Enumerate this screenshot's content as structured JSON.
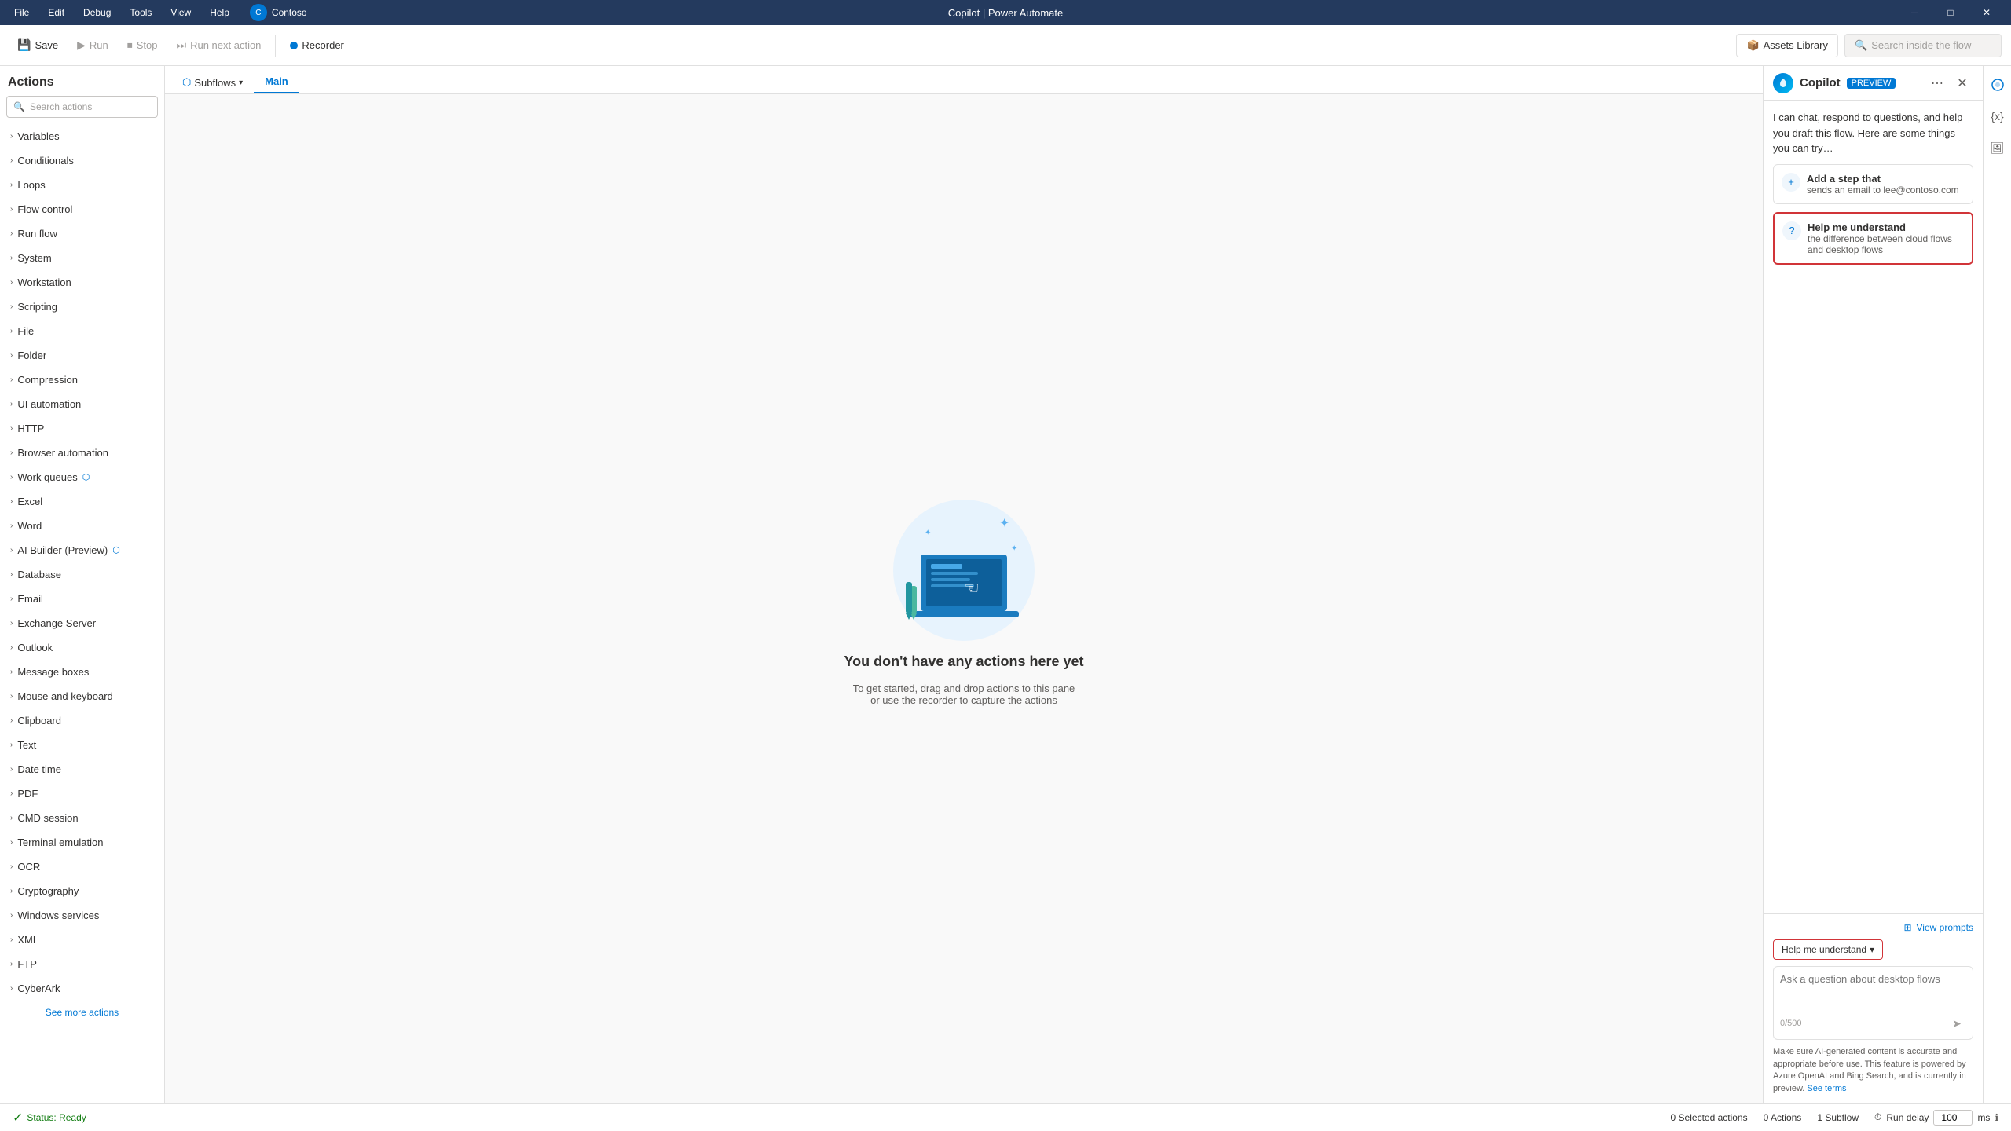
{
  "titlebar": {
    "app_name": "Copilot | Power Automate",
    "menu": [
      "File",
      "Edit",
      "Debug",
      "Tools",
      "View",
      "Help"
    ],
    "user": "Contoso",
    "minimize": "─",
    "restore": "□",
    "close": "✕"
  },
  "toolbar": {
    "save_label": "Save",
    "run_label": "Run",
    "stop_label": "Stop",
    "run_next_label": "Run next action",
    "recorder_label": "Recorder",
    "assets_label": "Assets Library",
    "search_flow_placeholder": "Search inside the flow"
  },
  "actions_panel": {
    "title": "Actions",
    "search_placeholder": "Search actions",
    "items": [
      {
        "label": "Variables"
      },
      {
        "label": "Conditionals"
      },
      {
        "label": "Loops"
      },
      {
        "label": "Flow control"
      },
      {
        "label": "Run flow"
      },
      {
        "label": "System"
      },
      {
        "label": "Workstation"
      },
      {
        "label": "Scripting"
      },
      {
        "label": "File"
      },
      {
        "label": "Folder"
      },
      {
        "label": "Compression"
      },
      {
        "label": "UI automation"
      },
      {
        "label": "HTTP"
      },
      {
        "label": "Browser automation"
      },
      {
        "label": "Work queues"
      },
      {
        "label": "Excel"
      },
      {
        "label": "Word"
      },
      {
        "label": "AI Builder (Preview)"
      },
      {
        "label": "Database"
      },
      {
        "label": "Email"
      },
      {
        "label": "Exchange Server"
      },
      {
        "label": "Outlook"
      },
      {
        "label": "Message boxes"
      },
      {
        "label": "Mouse and keyboard"
      },
      {
        "label": "Clipboard"
      },
      {
        "label": "Text"
      },
      {
        "label": "Date time"
      },
      {
        "label": "PDF"
      },
      {
        "label": "CMD session"
      },
      {
        "label": "Terminal emulation"
      },
      {
        "label": "OCR"
      },
      {
        "label": "Cryptography"
      },
      {
        "label": "Windows services"
      },
      {
        "label": "XML"
      },
      {
        "label": "FTP"
      },
      {
        "label": "CyberArk"
      }
    ],
    "see_more_label": "See more actions"
  },
  "flow_canvas": {
    "subflows_label": "Subflows",
    "main_tab_label": "Main",
    "empty_title": "You don't have any actions here yet",
    "empty_subtitle_line1": "To get started, drag and drop actions to this pane",
    "empty_subtitle_line2": "or use the recorder to capture the actions"
  },
  "copilot": {
    "title": "Copilot",
    "preview_label": "PREVIEW",
    "intro": "I can chat, respond to questions, and help you draft this flow. Here are some things you can try…",
    "suggestion1_title": "Add a step that",
    "suggestion1_sub": "sends an email to lee@contoso.com",
    "suggestion2_title": "Help me understand",
    "suggestion2_sub": "the difference between cloud flows and desktop flows",
    "view_prompts_label": "View prompts",
    "help_understand_label": "Help me understand",
    "input_placeholder": "Ask a question about desktop flows",
    "char_count": "0/500",
    "disclaimer": "Make sure AI-generated content is accurate and appropriate before use. This feature is powered by Azure OpenAI and Bing Search, and is currently in preview.",
    "see_terms_label": "See terms"
  },
  "statusbar": {
    "status_label": "Status: Ready",
    "selected_actions": "0 Selected actions",
    "actions_count": "0 Actions",
    "subflow_count": "1 Subflow",
    "run_delay_label": "Run delay",
    "run_delay_value": "100",
    "run_delay_unit": "ms"
  }
}
